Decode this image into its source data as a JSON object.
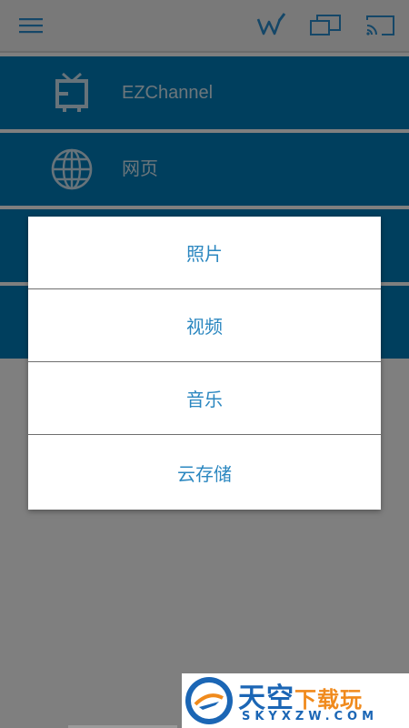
{
  "toolbar": {
    "icons": [
      "hamburger-menu-icon",
      "w-pen-icon",
      "screen-mirror-icon",
      "cast-icon"
    ]
  },
  "menu": {
    "items": [
      {
        "label": "EZChannel",
        "icon": "tv-icon"
      },
      {
        "label": "网页",
        "icon": "globe-icon"
      },
      {
        "label": "",
        "icon": ""
      },
      {
        "label": "",
        "icon": ""
      }
    ]
  },
  "dialog": {
    "options": [
      {
        "label": "照片"
      },
      {
        "label": "视频"
      },
      {
        "label": "音乐"
      },
      {
        "label": "云存储"
      }
    ]
  },
  "watermark": {
    "title": "天空",
    "title_accent": "下载玩",
    "subtitle": "SKYXZW.COM"
  },
  "colors": {
    "accent": "#007fbd",
    "dialog_text": "#2b87c0",
    "toolbar_icon": "#2a8fd0"
  }
}
